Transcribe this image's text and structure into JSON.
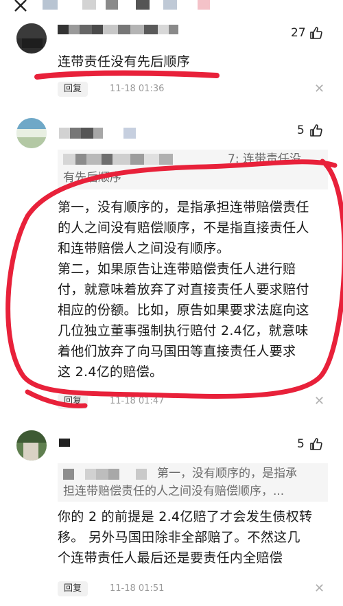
{
  "header": {
    "back_icon": "close-icon"
  },
  "comments": [
    {
      "likes": "27",
      "text": "连带责任没有先后顺序",
      "reply_label": "回复",
      "time": "11-18 01:36"
    },
    {
      "likes": "5",
      "quote_line1_tail": "7:  连带责任没",
      "quote_line2": "有先后顺序",
      "text_lines": [
        "第一，没有顺序的，是指承担连带赔偿责任",
        "的人之间没有赔偿顺序，不是指直接责任人",
        "和连带赔偿人之间没有顺序。",
        "第二，如果原告让连带赔偿责任人进行赔",
        "付，就意味着放弃了对直接责任人要求赔付",
        "相应的份额。比如，原告如果要求法庭向这",
        "几位独立董事强制执行赔付 2.4亿，就意味",
        "着他们放弃了向马国田等直接责任人要求",
        "这 2.4亿的赔偿。"
      ],
      "reply_label": "回复",
      "time": "11-18 01:47"
    },
    {
      "likes": "5",
      "quote_line1_tail": "第一，没有顺序的，是指承",
      "quote_line2": "担连带赔偿责任的人之间没有赔偿顺序，...",
      "text_lines": [
        "你的 2 的前提是 2.4亿赔了才会发生债权转",
        "移。 另外马国田除非全部赔了。不然这几",
        "个连带责任人最后还是要责任内全赔偿"
      ],
      "reply_label": "回复",
      "time": "11-18 01:51"
    }
  ],
  "colors": {
    "annotation_red": "#e8213a",
    "muted": "#9a9a9a"
  }
}
